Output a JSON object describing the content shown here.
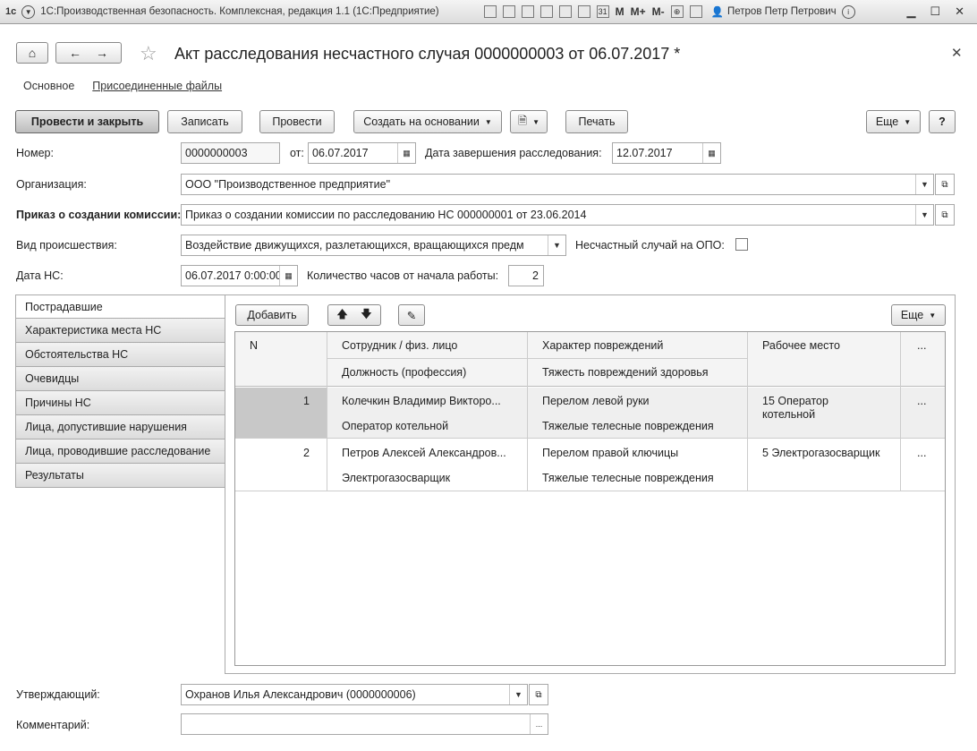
{
  "titlebar": {
    "logo": "1с",
    "title": "1С:Производственная безопасность. Комплексная, редакция 1.1  (1С:Предприятие)",
    "m": "M",
    "m_plus": "M+",
    "m_minus": "M-",
    "user": "Петров Петр Петрович"
  },
  "form": {
    "title": "Акт расследования несчастного случая 0000000003 от 06.07.2017 *",
    "sections": [
      "Основное",
      "Присоединенные файлы"
    ]
  },
  "toolbar": {
    "post_close": "Провести и закрыть",
    "save": "Записать",
    "post": "Провести",
    "create_based": "Создать на основании",
    "print": "Печать",
    "more": "Еще",
    "help": "?"
  },
  "fields": {
    "number_label": "Номер:",
    "number": "0000000003",
    "from_label": "от:",
    "date": "06.07.2017",
    "end_date_label": "Дата завершения расследования:",
    "end_date": "12.07.2017",
    "org_label": "Организация:",
    "org": "ООО \"Производственное предприятие\"",
    "order_label": "Приказ о создании комиссии:",
    "order": "Приказ о создании комиссии по расследованию НС 000000001 от 23.06.2014",
    "incident_label": "Вид происшествия:",
    "incident": "Воздействие движущихся, разлетающихся, вращающихся предм",
    "opo_label": "Несчастный случай на ОПО:",
    "ns_date_label": "Дата НС:",
    "ns_date": "06.07.2017  0:00:00",
    "hours_label": "Количество часов от начала работы:",
    "hours": "2",
    "approver_label": "Утверждающий:",
    "approver": "Охранов Илья Александрович (0000000006)",
    "comment_label": "Комментарий:",
    "comment": ""
  },
  "tabs": [
    "Пострадавшие",
    "Характеристика места НС",
    "Обстоятельства НС",
    "Очевидцы",
    "Причины НС",
    "Лица, допустившие нарушения",
    "Лица, проводившие расследование",
    "Результаты"
  ],
  "table": {
    "add": "Добавить",
    "more": "Еще",
    "headers": {
      "n": "N",
      "employee": "Сотрудник / физ. лицо",
      "position": "Должность (профессия)",
      "injury": "Характер повреждений",
      "severity": "Тяжесть повреждений здоровья",
      "workplace": "Рабочее место",
      "extra": "..."
    },
    "rows": [
      {
        "n": "1",
        "employee": "Колечкин Владимир Викторо...",
        "position": "Оператор котельной",
        "injury": "Перелом левой руки",
        "severity": "Тяжелые телесные повреждения",
        "workplace_1": "15 Оператор",
        "workplace_2": "котельной",
        "extra": "..."
      },
      {
        "n": "2",
        "employee": "Петров Алексей Александров...",
        "position": "Электрогазосварщик",
        "injury": "Перелом правой ключицы",
        "severity": "Тяжелые телесные повреждения",
        "workplace_1": "5 Электрогазосварщик",
        "workplace_2": "",
        "extra": "..."
      }
    ]
  }
}
